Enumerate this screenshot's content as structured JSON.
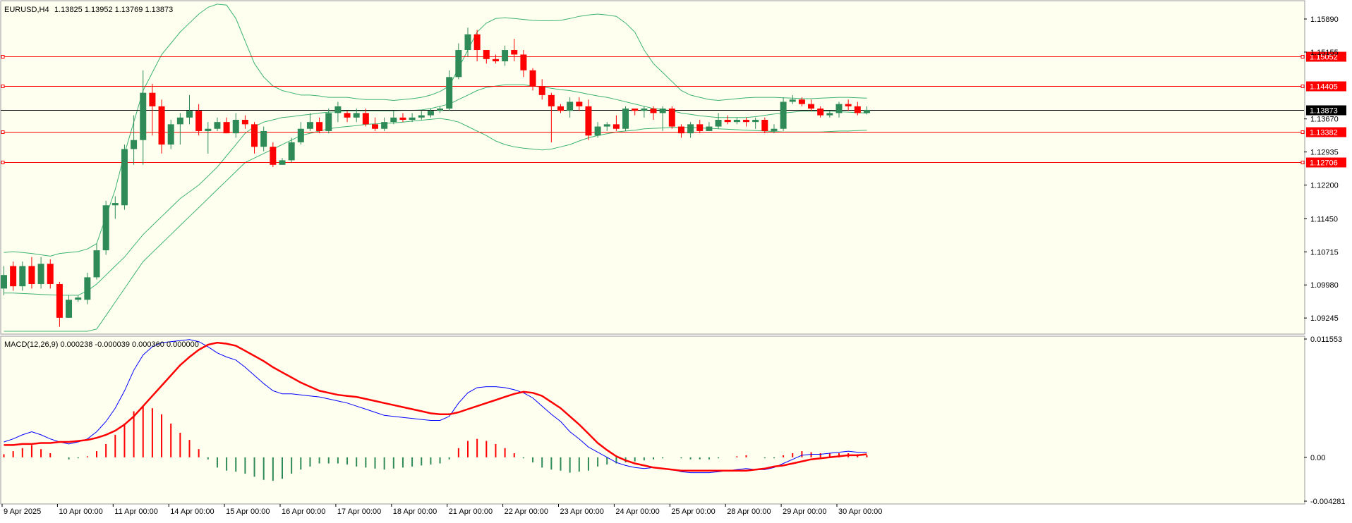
{
  "header": {
    "symbol": "EURUSD,H4",
    "ohlc": "1.13825 1.13952 1.13769 1.13873"
  },
  "indicator": {
    "label": "MACD(12,26,9) 0.000238 -0.000039 0.000360 0.000000"
  },
  "colors": {
    "background": "#fffff0",
    "bull": "#2e8b57",
    "bear": "#ff0000",
    "bands": "#3cb371",
    "hline": "#ff0000",
    "current": "#000000",
    "macd_main": "#0000ff",
    "macd_signal": "#ff0000"
  },
  "chart_data": [
    {
      "type": "candlestick",
      "symbol": "EURUSD",
      "timeframe": "H4",
      "ylim": [
        1.0895,
        1.1625
      ],
      "price_ticks": [
        "1.15890",
        "1.15155",
        "1.13670",
        "1.12935",
        "1.12200",
        "1.11450",
        "1.10715",
        "1.09980",
        "1.09245"
      ],
      "x_labels": [
        "9 Apr 2025",
        "10 Apr 00:00",
        "11 Apr 00:00",
        "14 Apr 00:00",
        "15 Apr 00:00",
        "16 Apr 00:00",
        "17 Apr 00:00",
        "18 Apr 00:00",
        "21 Apr 00:00",
        "22 Apr 00:00",
        "23 Apr 00:00",
        "24 Apr 00:00",
        "25 Apr 00:00",
        "28 Apr 00:00",
        "29 Apr 00:00",
        "30 Apr 00:00"
      ],
      "horizontal_levels": [
        "1.15052",
        "1.14405",
        "1.13382",
        "1.12706"
      ],
      "current_price": "1.13873",
      "candles": [
        [
          1.099,
          1.102,
          1.0975,
          1.104
        ],
        [
          1.104,
          1.0995,
          1.0985,
          1.105
        ],
        [
          1.0995,
          1.104,
          1.0985,
          1.105
        ],
        [
          1.104,
          1.1,
          1.099,
          1.106
        ],
        [
          1.1,
          1.1045,
          1.099,
          1.106
        ],
        [
          1.1045,
          1.1,
          1.099,
          1.1055
        ],
        [
          1.1,
          1.0925,
          1.0905,
          1.1005
        ],
        [
          1.0925,
          1.0965,
          1.0925,
          1.0975
        ],
        [
          1.0965,
          1.097,
          1.096,
          1.0975
        ],
        [
          1.0965,
          1.1015,
          1.0955,
          1.1025
        ],
        [
          1.1015,
          1.1075,
          1.101,
          1.109
        ],
        [
          1.1075,
          1.1175,
          1.1065,
          1.1185
        ],
        [
          1.1175,
          1.118,
          1.1145,
          1.1195
        ],
        [
          1.1175,
          1.13,
          1.1165,
          1.131
        ],
        [
          1.13,
          1.132,
          1.1265,
          1.1375
        ],
        [
          1.132,
          1.1425,
          1.1265,
          1.1475
        ],
        [
          1.1425,
          1.1395,
          1.133,
          1.1445
        ],
        [
          1.1395,
          1.131,
          1.129,
          1.141
        ],
        [
          1.131,
          1.1355,
          1.13,
          1.1365
        ],
        [
          1.1355,
          1.137,
          1.131,
          1.138
        ],
        [
          1.137,
          1.1385,
          1.1355,
          1.142
        ],
        [
          1.1385,
          1.134,
          1.133,
          1.14
        ],
        [
          1.134,
          1.1345,
          1.129,
          1.136
        ],
        [
          1.1345,
          1.136,
          1.134,
          1.137
        ],
        [
          1.136,
          1.1335,
          1.1335,
          1.137
        ],
        [
          1.1335,
          1.1365,
          1.1325,
          1.138
        ],
        [
          1.1365,
          1.1355,
          1.1345,
          1.1375
        ],
        [
          1.1355,
          1.1305,
          1.129,
          1.136
        ],
        [
          1.1305,
          1.134,
          1.1295,
          1.135
        ],
        [
          1.1305,
          1.1265,
          1.126,
          1.1315
        ],
        [
          1.1265,
          1.1275,
          1.127,
          1.128
        ],
        [
          1.1275,
          1.1315,
          1.127,
          1.1325
        ],
        [
          1.1315,
          1.1345,
          1.131,
          1.136
        ],
        [
          1.1345,
          1.136,
          1.134,
          1.138
        ],
        [
          1.136,
          1.134,
          1.1335,
          1.137
        ],
        [
          1.134,
          1.138,
          1.1335,
          1.139
        ],
        [
          1.138,
          1.1395,
          1.136,
          1.1405
        ],
        [
          1.138,
          1.137,
          1.136,
          1.1385
        ],
        [
          1.137,
          1.138,
          1.136,
          1.139
        ],
        [
          1.138,
          1.1355,
          1.135,
          1.139
        ],
        [
          1.1355,
          1.1345,
          1.134,
          1.137
        ],
        [
          1.1345,
          1.136,
          1.134,
          1.137
        ],
        [
          1.136,
          1.137,
          1.1355,
          1.1385
        ],
        [
          1.137,
          1.1365,
          1.136,
          1.138
        ],
        [
          1.1365,
          1.137,
          1.136,
          1.138
        ],
        [
          1.137,
          1.1375,
          1.1365,
          1.1385
        ],
        [
          1.1375,
          1.1385,
          1.137,
          1.139
        ],
        [
          1.1385,
          1.139,
          1.138,
          1.1395
        ],
        [
          1.139,
          1.146,
          1.1385,
          1.1475
        ],
        [
          1.146,
          1.152,
          1.1455,
          1.1535
        ],
        [
          1.152,
          1.1555,
          1.1505,
          1.157
        ],
        [
          1.1555,
          1.152,
          1.1495,
          1.1565
        ],
        [
          1.152,
          1.15,
          1.149,
          1.152
        ],
        [
          1.15,
          1.1495,
          1.149,
          1.151
        ],
        [
          1.1495,
          1.152,
          1.1485,
          1.153
        ],
        [
          1.152,
          1.151,
          1.1495,
          1.1545
        ],
        [
          1.151,
          1.1475,
          1.146,
          1.152
        ],
        [
          1.1475,
          1.144,
          1.143,
          1.148
        ],
        [
          1.144,
          1.142,
          1.141,
          1.1455
        ],
        [
          1.142,
          1.1395,
          1.1315,
          1.1425
        ],
        [
          1.1395,
          1.1385,
          1.138,
          1.14
        ],
        [
          1.1385,
          1.1405,
          1.137,
          1.1415
        ],
        [
          1.1405,
          1.1395,
          1.1385,
          1.1415
        ],
        [
          1.1395,
          1.133,
          1.132,
          1.141
        ],
        [
          1.133,
          1.135,
          1.1325,
          1.136
        ],
        [
          1.135,
          1.1355,
          1.134,
          1.136
        ],
        [
          1.1355,
          1.1345,
          1.134,
          1.1375
        ],
        [
          1.1345,
          1.139,
          1.134,
          1.1395
        ],
        [
          1.139,
          1.1385,
          1.1375,
          1.139
        ],
        [
          1.1385,
          1.139,
          1.137,
          1.1395
        ],
        [
          1.139,
          1.138,
          1.1365,
          1.1395
        ],
        [
          1.138,
          1.139,
          1.134,
          1.1395
        ],
        [
          1.139,
          1.135,
          1.1345,
          1.1395
        ],
        [
          1.135,
          1.1335,
          1.1325,
          1.1355
        ],
        [
          1.1335,
          1.1355,
          1.1325,
          1.136
        ],
        [
          1.1355,
          1.134,
          1.1335,
          1.1365
        ],
        [
          1.134,
          1.135,
          1.134,
          1.136
        ],
        [
          1.135,
          1.1365,
          1.1345,
          1.138
        ],
        [
          1.1365,
          1.136,
          1.1355,
          1.1375
        ],
        [
          1.136,
          1.1365,
          1.1355,
          1.137
        ],
        [
          1.1365,
          1.136,
          1.135,
          1.137
        ],
        [
          1.136,
          1.1365,
          1.1345,
          1.137
        ],
        [
          1.1365,
          1.134,
          1.1335,
          1.137
        ],
        [
          1.134,
          1.1345,
          1.1335,
          1.1355
        ],
        [
          1.1345,
          1.1405,
          1.134,
          1.1415
        ],
        [
          1.1405,
          1.141,
          1.14,
          1.142
        ],
        [
          1.141,
          1.14,
          1.1395,
          1.1415
        ],
        [
          1.14,
          1.139,
          1.1385,
          1.141
        ],
        [
          1.139,
          1.1375,
          1.137,
          1.1395
        ],
        [
          1.1375,
          1.138,
          1.137,
          1.1385
        ],
        [
          1.138,
          1.14,
          1.137,
          1.1405
        ],
        [
          1.14,
          1.1395,
          1.1385,
          1.141
        ],
        [
          1.1395,
          1.138,
          1.1375,
          1.1405
        ],
        [
          1.138,
          1.1387,
          1.1377,
          1.1395
        ]
      ],
      "bollinger": {
        "upper": [
          1.107,
          1.1072,
          1.107,
          1.1068,
          1.1065,
          1.1062,
          1.1068,
          1.107,
          1.1072,
          1.1078,
          1.109,
          1.115,
          1.121,
          1.129,
          1.136,
          1.143,
          1.147,
          1.151,
          1.1535,
          1.156,
          1.158,
          1.16,
          1.1615,
          1.1622,
          1.162,
          1.159,
          1.154,
          1.149,
          1.146,
          1.144,
          1.143,
          1.1425,
          1.142,
          1.142,
          1.1418,
          1.1415,
          1.1415,
          1.1415,
          1.1412,
          1.141,
          1.141,
          1.141,
          1.1408,
          1.141,
          1.1412,
          1.1415,
          1.142,
          1.1428,
          1.144,
          1.148,
          1.152,
          1.156,
          1.158,
          1.159,
          1.1592,
          1.159,
          1.1588,
          1.1586,
          1.1585,
          1.1585,
          1.1586,
          1.159,
          1.1595,
          1.1598,
          1.16,
          1.1598,
          1.1595,
          1.158,
          1.156,
          1.152,
          1.149,
          1.147,
          1.145,
          1.143,
          1.142,
          1.1415,
          1.141,
          1.1408,
          1.141,
          1.1412,
          1.1414,
          1.1415,
          1.1415,
          1.1415,
          1.1414,
          1.1413,
          1.1412,
          1.1412,
          1.1413,
          1.1414,
          1.1415,
          1.1415,
          1.1414,
          1.1413
        ],
        "middle": [
          1.098,
          1.098,
          1.0979,
          1.0978,
          1.0977,
          1.0976,
          1.0975,
          1.0975,
          1.0975,
          1.0985,
          1.1,
          1.102,
          1.104,
          1.106,
          1.1085,
          1.111,
          1.113,
          1.115,
          1.117,
          1.119,
          1.1205,
          1.122,
          1.124,
          1.126,
          1.1285,
          1.131,
          1.1335,
          1.135,
          1.136,
          1.1365,
          1.137,
          1.1372,
          1.1375,
          1.1377,
          1.138,
          1.1382,
          1.1383,
          1.1385,
          1.1385,
          1.1385,
          1.1385,
          1.1385,
          1.1385,
          1.1386,
          1.1386,
          1.1387,
          1.139,
          1.1395,
          1.14,
          1.141,
          1.142,
          1.143,
          1.1437,
          1.144,
          1.1443,
          1.1443,
          1.1443,
          1.144,
          1.1438,
          1.1435,
          1.1432,
          1.143,
          1.1426,
          1.1422,
          1.1418,
          1.1415,
          1.141,
          1.1405,
          1.14,
          1.1395,
          1.139,
          1.1388,
          1.1385,
          1.138,
          1.1377,
          1.1374,
          1.1372,
          1.137,
          1.137,
          1.137,
          1.137,
          1.1372,
          1.1375,
          1.1378,
          1.138,
          1.1382,
          1.1384,
          1.1384,
          1.1384,
          1.1384,
          1.1383,
          1.1382,
          1.1381,
          1.138
        ],
        "lower": [
          1.088,
          1.0888,
          1.0889,
          1.0888,
          1.0889,
          1.089,
          1.0882,
          1.088,
          1.088,
          1.0885,
          1.09,
          1.093,
          1.096,
          1.099,
          1.102,
          1.105,
          1.107,
          1.109,
          1.111,
          1.113,
          1.115,
          1.117,
          1.119,
          1.121,
          1.123,
          1.125,
          1.127,
          1.128,
          1.129,
          1.13,
          1.131,
          1.132,
          1.133,
          1.1335,
          1.134,
          1.1345,
          1.1348,
          1.135,
          1.1352,
          1.1355,
          1.1356,
          1.1357,
          1.1358,
          1.136,
          1.1362,
          1.1364,
          1.1366,
          1.1368,
          1.1365,
          1.136,
          1.135,
          1.134,
          1.133,
          1.1318,
          1.131,
          1.1305,
          1.1302,
          1.13,
          1.1298,
          1.13,
          1.1305,
          1.131,
          1.1318,
          1.1325,
          1.133,
          1.1334,
          1.1338,
          1.134,
          1.1342,
          1.1345,
          1.1346,
          1.1347,
          1.1348,
          1.1348,
          1.1348,
          1.1347,
          1.1346,
          1.1345,
          1.1344,
          1.1343,
          1.1342,
          1.1341,
          1.134,
          1.1339,
          1.1338,
          1.1338,
          1.1338,
          1.1338,
          1.1338,
          1.1339,
          1.134,
          1.134,
          1.1341,
          1.1342
        ]
      }
    },
    {
      "type": "bar+line",
      "indicator": "MACD(12,26,9)",
      "ylim": [
        -0.004281,
        0.011553
      ],
      "y_ticks": [
        "0.011553",
        "0.00",
        "-0.004281"
      ],
      "main": [
        0.0015,
        0.0018,
        0.0022,
        0.0025,
        0.0022,
        0.0018,
        0.0015,
        0.0013,
        0.0015,
        0.0018,
        0.0025,
        0.0035,
        0.0048,
        0.0065,
        0.0085,
        0.01,
        0.0108,
        0.0112,
        0.0113,
        0.0114,
        0.0115,
        0.0113,
        0.0108,
        0.0102,
        0.0098,
        0.0095,
        0.0088,
        0.008,
        0.0072,
        0.0065,
        0.0062,
        0.0062,
        0.0061,
        0.006,
        0.0059,
        0.0057,
        0.0055,
        0.0053,
        0.005,
        0.0047,
        0.0044,
        0.0041,
        0.004,
        0.0039,
        0.0038,
        0.0037,
        0.0036,
        0.0036,
        0.004,
        0.0053,
        0.0063,
        0.0068,
        0.0069,
        0.0069,
        0.0068,
        0.0066,
        0.0063,
        0.0058,
        0.005,
        0.0042,
        0.0035,
        0.0025,
        0.0018,
        0.001,
        0.0005,
        0.0,
        -0.0005,
        -0.0008,
        -0.001,
        -0.0011,
        -0.001,
        -0.0011,
        -0.0012,
        -0.0014,
        -0.0015,
        -0.0015,
        -0.0015,
        -0.0014,
        -0.0013,
        -0.0012,
        -0.0011,
        -0.0012,
        -0.0012,
        -0.001,
        -0.0006,
        -0.0002,
        0.0002,
        0.0003,
        0.0003,
        0.0004,
        0.0005,
        0.0006,
        0.0005,
        0.0005
      ],
      "signal": [
        0.0012,
        0.0012,
        0.0013,
        0.0013,
        0.0014,
        0.0014,
        0.0015,
        0.0015,
        0.0016,
        0.0017,
        0.0019,
        0.0022,
        0.0026,
        0.0032,
        0.004,
        0.005,
        0.006,
        0.007,
        0.008,
        0.009,
        0.0098,
        0.0105,
        0.011,
        0.0112,
        0.0111,
        0.0109,
        0.0104,
        0.0099,
        0.0094,
        0.0088,
        0.0083,
        0.0078,
        0.0073,
        0.0069,
        0.0065,
        0.0063,
        0.0061,
        0.006,
        0.0059,
        0.0057,
        0.0055,
        0.0053,
        0.0051,
        0.0049,
        0.0047,
        0.0045,
        0.0043,
        0.0042,
        0.0042,
        0.0044,
        0.0047,
        0.005,
        0.0053,
        0.0056,
        0.0059,
        0.0062,
        0.0064,
        0.0063,
        0.006,
        0.0054,
        0.0048,
        0.004,
        0.0032,
        0.0023,
        0.0014,
        0.0007,
        0.0001,
        -0.0003,
        -0.0006,
        -0.0008,
        -0.001,
        -0.0011,
        -0.0012,
        -0.0013,
        -0.0013,
        -0.0013,
        -0.0013,
        -0.0013,
        -0.0013,
        -0.0013,
        -0.0013,
        -0.0012,
        -0.0011,
        -0.0009,
        -0.0008,
        -0.0006,
        -0.0004,
        -0.0002,
        -0.0001,
        0.0,
        0.0001,
        0.0002,
        0.0002,
        0.0003
      ],
      "histogram": [
        0.0003,
        0.0006,
        0.0009,
        0.0012,
        0.0008,
        0.0004,
        0.0,
        -0.0002,
        -0.0001,
        0.0001,
        0.0006,
        0.0013,
        0.0022,
        0.0033,
        0.0045,
        0.005,
        0.0048,
        0.0042,
        0.0033,
        0.0024,
        0.0017,
        0.0008,
        -0.0002,
        -0.001,
        -0.0013,
        -0.0014,
        -0.0016,
        -0.0019,
        -0.0022,
        -0.0023,
        -0.0021,
        -0.0016,
        -0.0012,
        -0.0009,
        -0.0006,
        -0.0006,
        -0.0006,
        -0.0007,
        -0.0009,
        -0.001,
        -0.0011,
        -0.0012,
        -0.0011,
        -0.001,
        -0.0009,
        -0.0008,
        -0.0007,
        -0.0006,
        -0.0002,
        0.0009,
        0.0016,
        0.0018,
        0.0016,
        0.0013,
        0.0009,
        0.0004,
        -0.0001,
        -0.0005,
        -0.001,
        -0.0012,
        -0.0013,
        -0.0015,
        -0.0014,
        -0.0013,
        -0.0009,
        -0.0007,
        -0.0006,
        -0.0005,
        -0.0004,
        -0.0003,
        -0.0002,
        -0.0001,
        0.0,
        -0.0001,
        -0.0002,
        -0.0002,
        -0.0002,
        -0.0001,
        0.0,
        0.0001,
        0.0002,
        0.0,
        -0.0001,
        -0.0001,
        0.0002,
        0.0004,
        0.0006,
        0.0005,
        0.0004,
        0.0004,
        0.0004,
        0.0004,
        0.0003,
        0.0002
      ]
    }
  ]
}
